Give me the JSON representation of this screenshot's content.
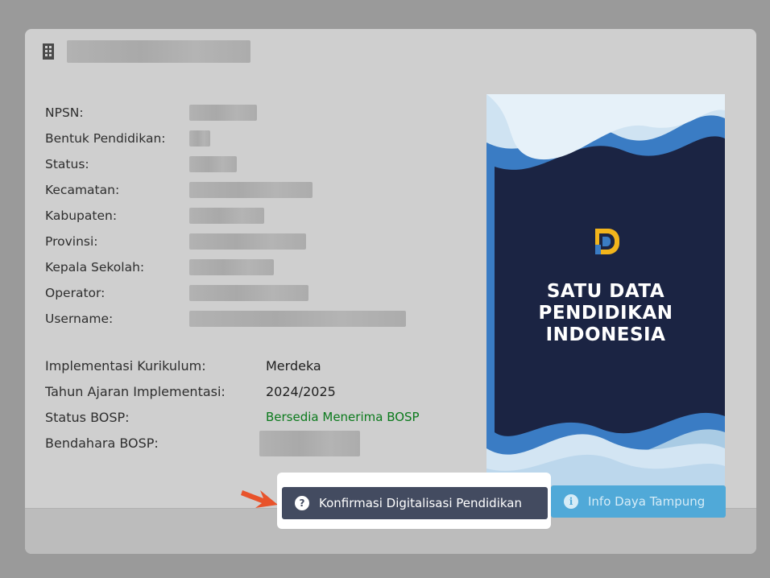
{
  "school": {
    "name_redacted": true,
    "icon": "building-icon"
  },
  "fields": [
    {
      "label": "NPSN:",
      "redacted": true
    },
    {
      "label": "Bentuk Pendidikan:",
      "redacted": true
    },
    {
      "label": "Status:",
      "redacted": true
    },
    {
      "label": "Kecamatan:",
      "redacted": true
    },
    {
      "label": "Kabupaten:",
      "redacted": true
    },
    {
      "label": "Provinsi:",
      "redacted": true
    },
    {
      "label": "Kepala Sekolah:",
      "redacted": true
    },
    {
      "label": "Operator:",
      "redacted": true
    },
    {
      "label": "Username:",
      "redacted": true
    }
  ],
  "implementation": {
    "kurikulum_label": "Implementasi Kurikulum:",
    "kurikulum_value": "Merdeka",
    "tahun_label": "Tahun Ajaran Implementasi:",
    "tahun_value": "2024/2025",
    "bosp_label": "Status BOSP:",
    "bosp_value": "Bersedia Menerima BOSP",
    "bendahara_label": "Bendahara BOSP:"
  },
  "poster": {
    "line1": "SATU DATA",
    "line2": "PENDIDIKAN",
    "line3": "INDONESIA",
    "logo_icon": "sdp-logo-icon"
  },
  "footer": {
    "konfirmasi_label": "Konfirmasi Digitalisasi Pendidikan",
    "konfirmasi_icon": "question-circle-icon",
    "info_label": "Info Daya Tampung",
    "info_icon": "info-circle-icon"
  },
  "colors": {
    "konfirmasi_bg": "#434b60",
    "info_bg": "#50a9d8",
    "bosp_green": "#0b7a1c",
    "arrow": "#e8532b",
    "poster_navy": "#1b2443"
  }
}
